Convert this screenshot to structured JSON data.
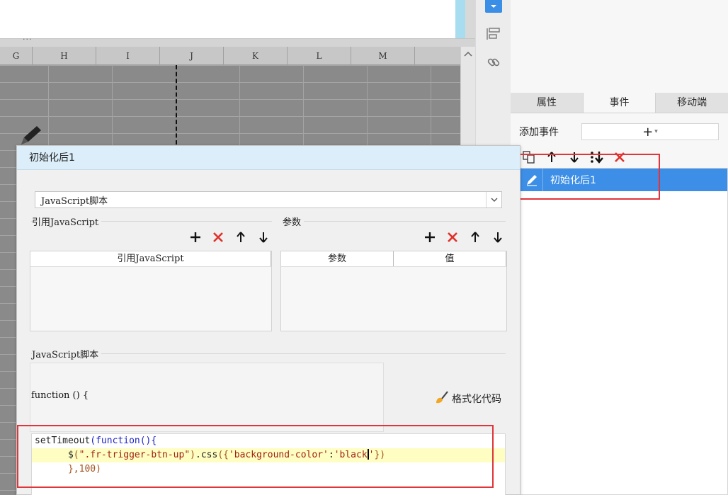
{
  "spreadsheet": {
    "columns": [
      "G",
      "H",
      "I",
      "J",
      "K",
      "L",
      "M"
    ],
    "split_handle": "···"
  },
  "properties_panel": {
    "tabs": [
      "属性",
      "事件",
      "移动端"
    ],
    "active_tab": "事件",
    "add_event_label": "添加事件",
    "add_event_symbol": "+",
    "add_event_caret": "▾",
    "events": [
      "初始化后1"
    ]
  },
  "dialog": {
    "title": "初始化后1",
    "type_select_value": "JavaScript脚本",
    "ref_js_group_label": "引用JavaScript",
    "ref_js_table_header": "引用JavaScript",
    "params_group_label": "参数",
    "params_columns": [
      "参数",
      "值"
    ],
    "script_group_label": "JavaScript脚本",
    "function_header": "function () {",
    "format_button_label": "格式化代码",
    "code": {
      "line1_kw": "setTimeout",
      "line1_open": "(",
      "line1_fn": "function",
      "line1_rest": "(){",
      "line2_indent": "      ",
      "line2_dollar": "$",
      "line2_open": "(",
      "line2_selector": "\".fr-trigger-btn-up\"",
      "line2_close": ")",
      "line2_method": ".css",
      "line2_args_open": "({",
      "line2_key": "'background-color'",
      "line2_colon": ":",
      "line2_value_before_caret": "'black",
      "line2_value_after_caret": "'",
      "line2_args_close": "})",
      "line3_indent": "      ",
      "line3_close": "},",
      "line3_num": "100",
      "line3_end": ")"
    }
  },
  "colors": {
    "accent_blue": "#3d8ee6",
    "dialog_title_bg": "#dbeefa",
    "highlight_red": "#e0353a",
    "delete_red": "#e0312a",
    "code_keyword": "#1e25c8",
    "code_string": "#a11f12",
    "line_highlight": "#fefec2"
  },
  "icons": {
    "strip": [
      "dropdown-icon",
      "layer-icon",
      "link-icon"
    ],
    "event_toolbar": [
      "copy-icon",
      "arrow-up-icon",
      "arrow-down-icon",
      "move-bottom-icon",
      "delete-icon"
    ],
    "event_item": "pencil-icon",
    "format_button": "brush-icon"
  }
}
